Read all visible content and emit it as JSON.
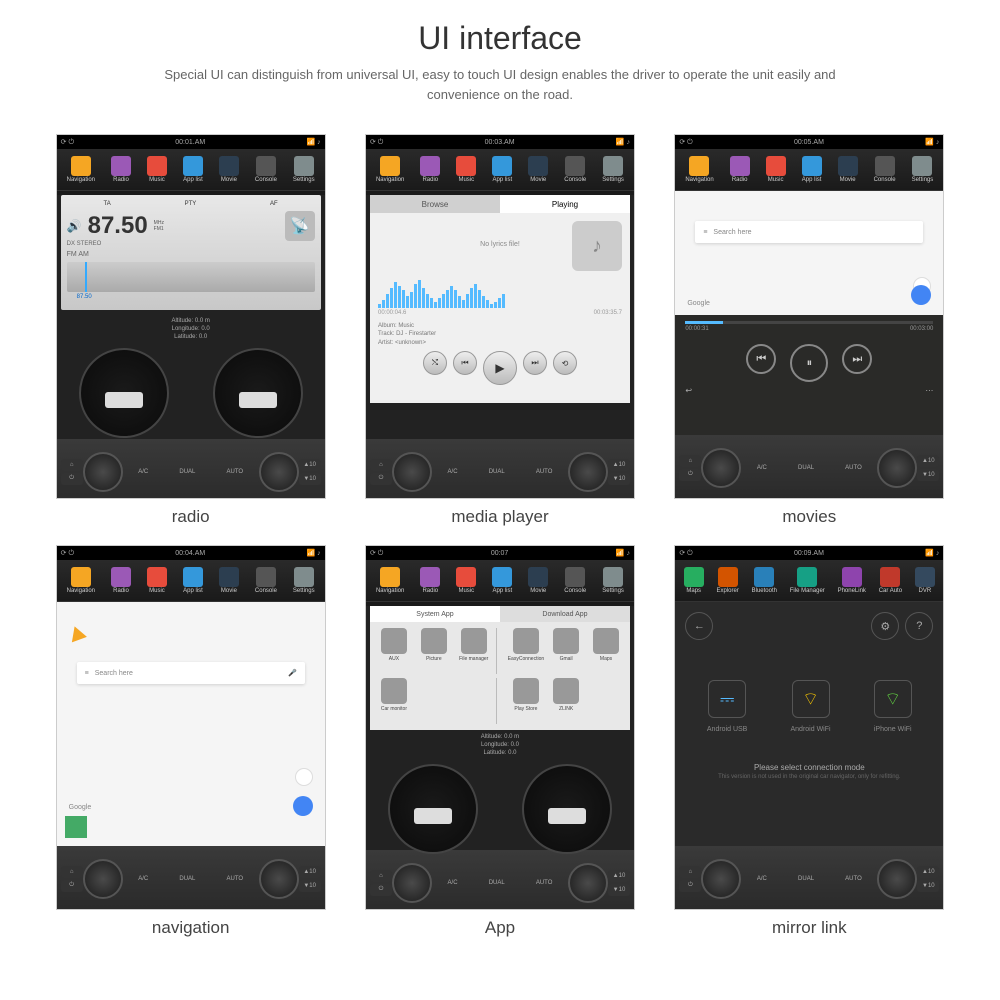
{
  "header": {
    "title": "UI interface",
    "subtitle": "Special UI can distinguish from universal UI, easy to touch UI design enables the driver to operate the unit easily and convenience on the road."
  },
  "captions": [
    "radio",
    "media player",
    "movies",
    "navigation",
    "App",
    "mirror link"
  ],
  "statusTimes": [
    "00:01.AM",
    "00:03.AM",
    "00:05.AM",
    "00:04.AM",
    "00:07",
    "00:09.AM"
  ],
  "topIcons": [
    "Navigation",
    "Radio",
    "Music",
    "App list",
    "Movie",
    "Console",
    "Settings"
  ],
  "topIconsML": [
    "Maps",
    "Explorer",
    "Bluetooth",
    "File Manager",
    "PhoneLink",
    "Car Auto",
    "DVR"
  ],
  "radio": {
    "tabs": [
      "TA",
      "PTY",
      "AF"
    ],
    "freq": "87.50",
    "unit": "MHz",
    "band": "FM1",
    "dx": "DX  STEREO",
    "bands": "FM     AM",
    "dialFreq": "87.50"
  },
  "gps": {
    "alt": "Altitude:  0.0 m",
    "lon": "Longitude:  0.0",
    "lat": "Latitude:  0.0"
  },
  "media": {
    "tabBrowse": "Browse",
    "tabPlaying": "Playing",
    "noLyrics": "No lyrics file!",
    "timeStart": "00:00:04.6",
    "timeEnd": "00:03:35.7",
    "album": "Album:   Music",
    "track": "Track:   DJ - Firestarter",
    "artist": "Artist:   <unknown>",
    "musicIcon": "♪"
  },
  "map": {
    "searchPlaceholder": "Search here",
    "brand": "Google"
  },
  "movie": {
    "start": "00:00:31",
    "end": "00:03:00"
  },
  "apps": {
    "tabSystem": "System App",
    "tabDownload": "Download App",
    "row1": [
      "AUX",
      "Picture",
      "File manager",
      "EasyConnection",
      "Gmail",
      "Maps"
    ],
    "row2": [
      "Car monitor",
      "",
      "",
      "Play Store",
      "ZLINK",
      ""
    ]
  },
  "mirror": {
    "opts": [
      "Android USB",
      "Android WiFi",
      "iPhone WiFi"
    ],
    "msg": "Please select connection mode",
    "sub": "This version is not used in the original car navigator, only for refitting."
  },
  "vol": {
    "up": "▲10",
    "down": "▼10"
  },
  "climate": [
    "A/C",
    "DUAL",
    "AUTO"
  ]
}
